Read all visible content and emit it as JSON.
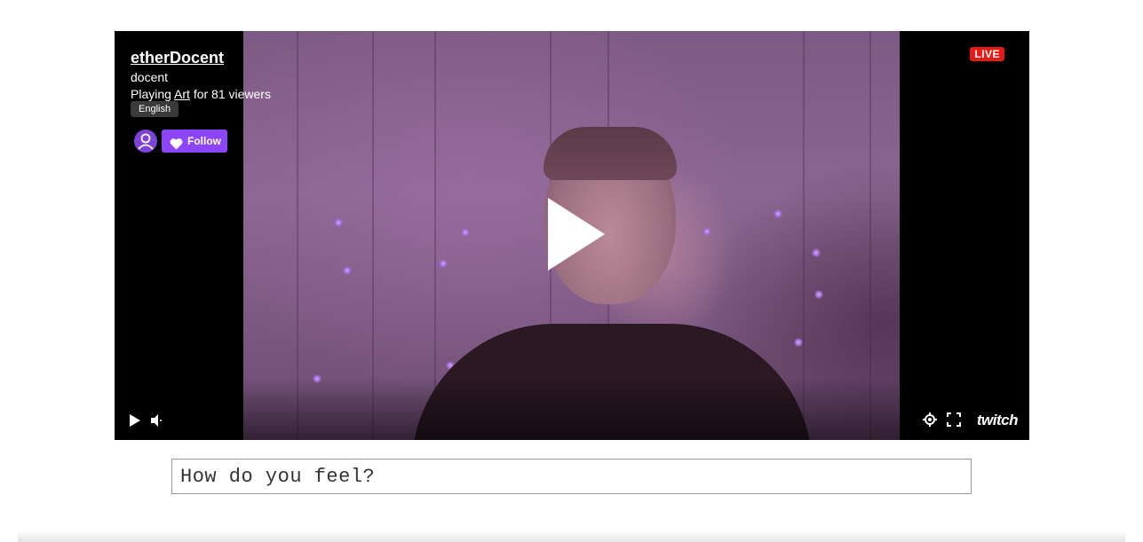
{
  "player": {
    "channel_name": "etherDocent",
    "channel_sub": "docent",
    "playing_prefix": "Playing",
    "game": "Art",
    "viewers_text": "for 81 viewers",
    "language": "English",
    "follow_label": "Follow",
    "live_label": "LIVE",
    "brand": "twitch",
    "icons": [
      "avatar-icon",
      "heart-icon",
      "play-icon",
      "volume-icon",
      "gear-icon",
      "fullscreen-icon"
    ],
    "colors": {
      "follow": "#8c45f7",
      "live": "#e91916",
      "video_tint": "#7d5a83"
    }
  },
  "feeling_input": {
    "placeholder": "How do you feel?",
    "value": ""
  }
}
